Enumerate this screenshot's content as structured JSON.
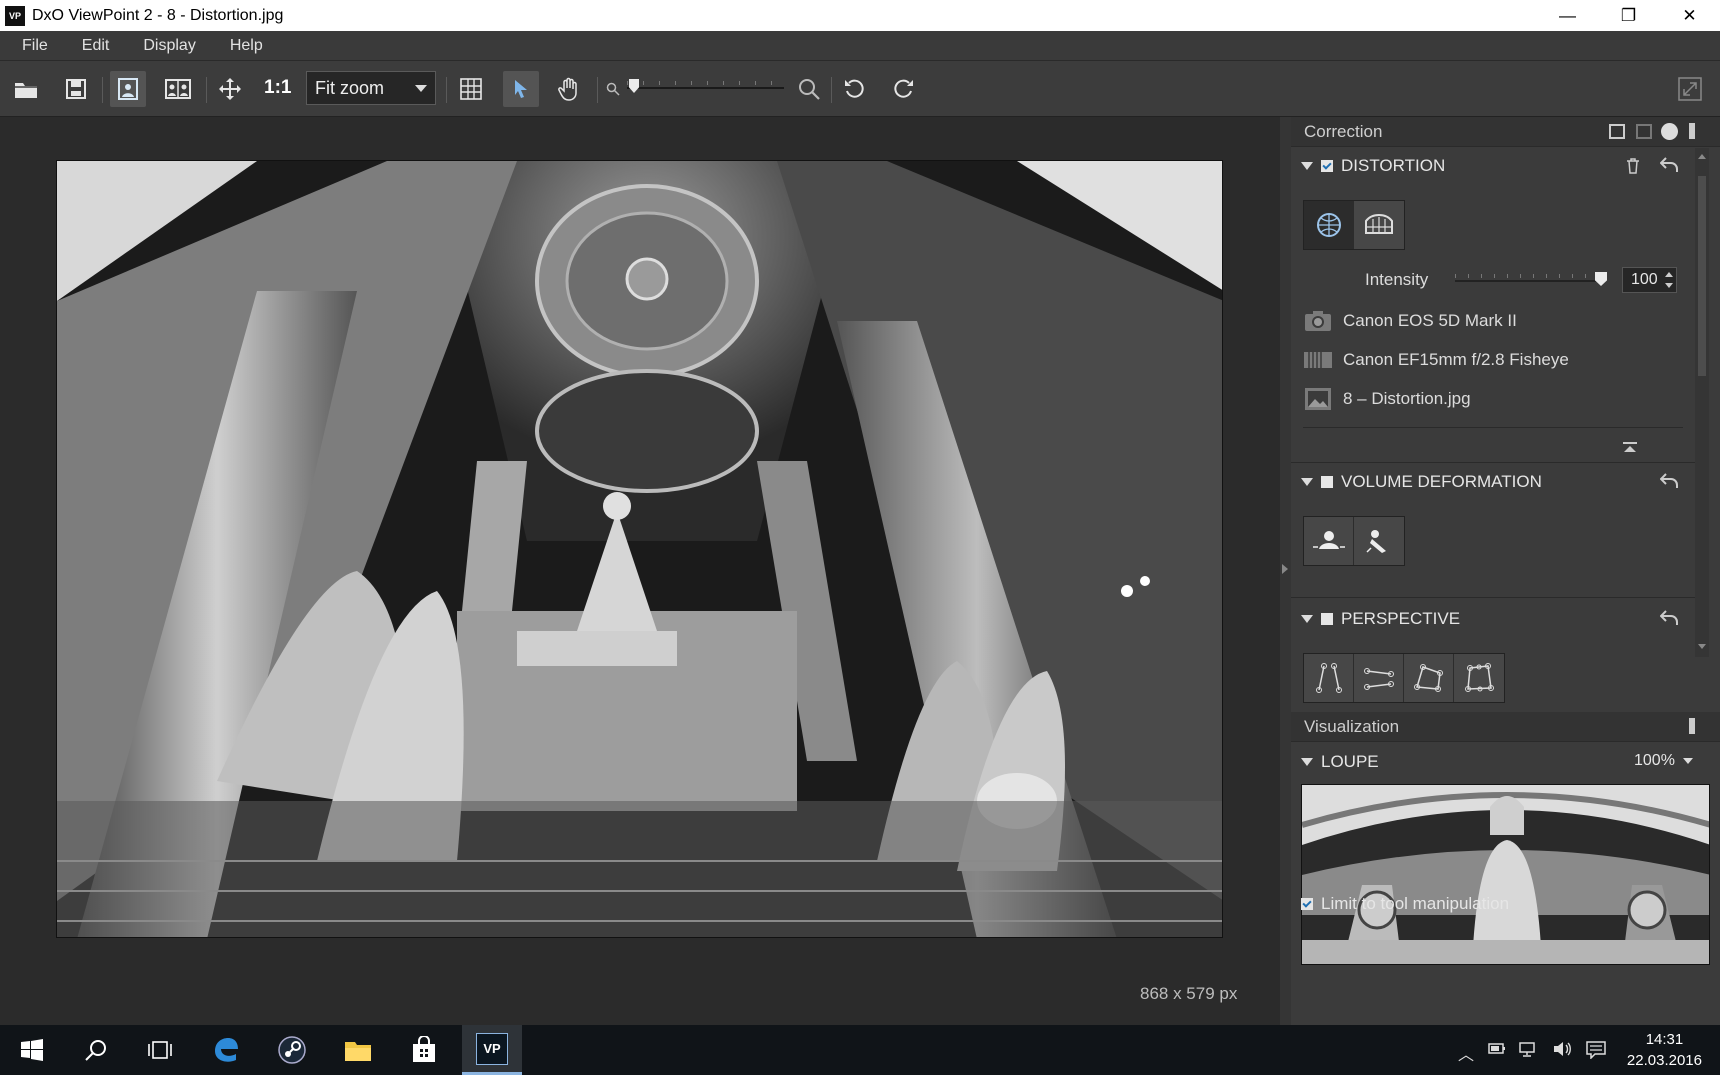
{
  "window": {
    "logo": "VP",
    "title": "DxO ViewPoint 2 - 8 - Distortion.jpg",
    "minimize": "—",
    "maximize": "❐",
    "close": "✕"
  },
  "menu": [
    "File",
    "Edit",
    "Display",
    "Help"
  ],
  "toolbar": {
    "one_to_one": "1:1",
    "zoom_value": "Fit zoom",
    "icons": [
      "open-folder-icon",
      "save-icon",
      "single-view-icon",
      "compare-view-icon",
      "move-icon",
      "grid-icon",
      "select-arrow-icon",
      "hand-icon",
      "zoom-out-icon",
      "zoom-in-icon",
      "rotate-left-icon",
      "rotate-right-icon",
      "fullscreen-icon"
    ]
  },
  "canvas": {
    "image_size": "868 x 579 px"
  },
  "correction": {
    "header": "Correction",
    "distortion": {
      "title": "DISTORTION",
      "enabled": true,
      "intensity_label": "Intensity",
      "intensity_value": "100",
      "camera": "Canon EOS 5D Mark II",
      "lens": "Canon EF15mm f/2.8 Fisheye",
      "file": "8 – Distortion.jpg"
    },
    "volume": {
      "title": "VOLUME DEFORMATION",
      "enabled": false
    },
    "perspective": {
      "title": "PERSPECTIVE",
      "enabled": false
    }
  },
  "visualization": {
    "header": "Visualization",
    "loupe_title": "LOUPE",
    "loupe_zoom": "100%",
    "limit_label": "Limit to tool manipulation",
    "limit_checked": true
  },
  "taskbar": {
    "time": "14:31",
    "date": "22.03.2016",
    "active_app": "VP"
  },
  "colors": {
    "accent": "#1f6fb2",
    "panel": "#3b3b3b",
    "canvas": "#2b2b2b"
  }
}
